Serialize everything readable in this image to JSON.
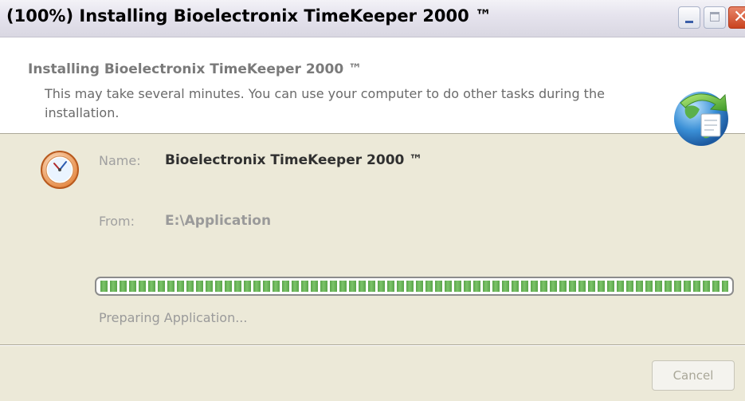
{
  "window": {
    "title": "(100%) Installing Bioelectronix TimeKeeper 2000 ™",
    "icons": {
      "minimize": "minimize-icon",
      "maximize": "maximize-icon",
      "close": "close-icon"
    }
  },
  "header": {
    "title": "Installing Bioelectronix TimeKeeper 2000 ™",
    "description": "This may take several minutes. You can use your computer to do other tasks during the installation.",
    "icon": "globe-install-icon"
  },
  "details": {
    "icon": "clock-icon",
    "name_label": "Name:",
    "name_value": "Bioelectronix TimeKeeper 2000 ™",
    "from_label": "From:",
    "from_value": "E:\\Application"
  },
  "progress": {
    "percent": 100,
    "status": "Preparing Application..."
  },
  "buttons": {
    "cancel_label": "Cancel",
    "cancel_enabled": false
  },
  "colors": {
    "progress_green": "#5aa44a",
    "window_background": "#ece9d8",
    "close_button": "#c9431f"
  }
}
